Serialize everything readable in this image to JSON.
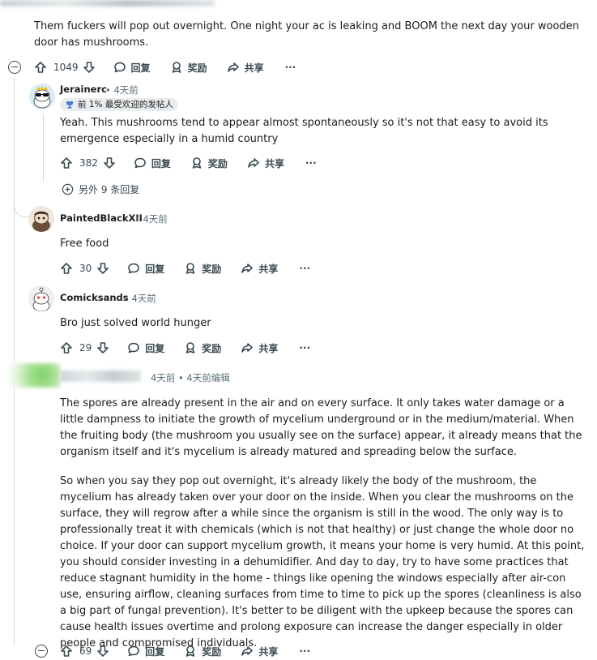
{
  "top_comment": {
    "body": "Them fuckers will pop out overnight. One night your ac is leaking and BOOM the next day your wooden door has mushrooms.",
    "votes": "1049"
  },
  "labels": {
    "reply": "回复",
    "award": "奖励",
    "share": "共享",
    "more": "···"
  },
  "replies": [
    {
      "author": "Jerainerc",
      "time": "• 4天前",
      "badge": "前 1% 最受欢迎的发帖人",
      "body": "Yeah. This mushrooms tend to appear almost spontaneously so it's not that easy to avoid its emergence especially in a humid country",
      "votes": "382",
      "more_replies": "另外 9 条回复"
    },
    {
      "author": "PaintedBlackXII",
      "time": "• 4天前",
      "body": "Free food",
      "votes": "30"
    },
    {
      "author": "Comicksands",
      "time": "• 4天前",
      "body": "Bro just solved world hunger",
      "votes": "29"
    },
    {
      "author": "",
      "time": "4天前 • 4天前编辑",
      "body_p1": "The spores are already present in the air and on every surface. It only takes water damage or a little dampness to initiate the growth of mycelium underground or in the medium/material. When the fruiting body (the mushroom you usually see on the surface) appear, it already means that the organism itself and it's mycelium is already matured and spreading below the surface.",
      "body_p2": "So when you say they pop out overnight, it's already likely the body of the mushroom, the mycelium has already taken over your door on the inside. When you clear the mushrooms on the surface, they will regrow after a while since the organism is still in the wood. The only way is to professionally treat it with chemicals (which is not that healthy) or just change the whole door no choice. If your door can support mycelium growth, it means your home is very humid. At this point, you should consider investing in a dehumidifier. And day to day, try to have some practices that reduce stagnant humidity in the home - things like opening the windows especially after air-con use, ensuring airflow, cleaning surfaces from time to time to pick up the spores (cleanliness is also a big part of fungal prevention). It's better to be diligent with the upkeep because the spores can cause health issues overtime and prolong exposure can increase the danger especially in older people and compromised individuals.",
      "votes": "69"
    }
  ]
}
